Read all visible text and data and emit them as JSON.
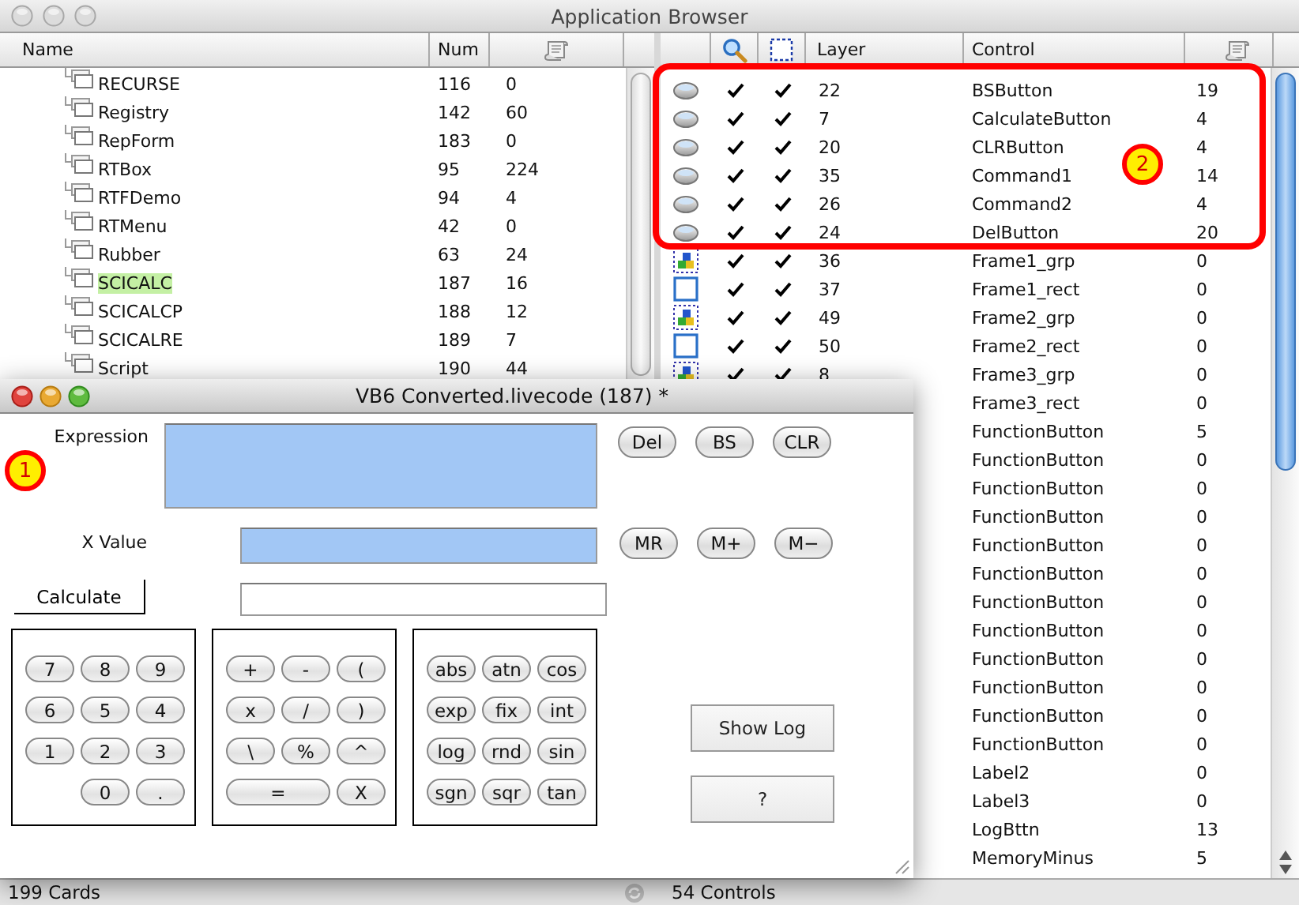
{
  "browser": {
    "title": "Application Browser",
    "active": false,
    "cards_header": {
      "name": "Name",
      "num": "Num"
    },
    "cards": [
      {
        "name": "RECURSE",
        "num": "116",
        "count": "0",
        "selected": false
      },
      {
        "name": "Registry",
        "num": "142",
        "count": "60",
        "selected": false
      },
      {
        "name": "RepForm",
        "num": "183",
        "count": "0",
        "selected": false
      },
      {
        "name": "RTBox",
        "num": "95",
        "count": "224",
        "selected": false
      },
      {
        "name": "RTFDemo",
        "num": "94",
        "count": "4",
        "selected": false
      },
      {
        "name": "RTMenu",
        "num": "42",
        "count": "0",
        "selected": false
      },
      {
        "name": "Rubber",
        "num": "63",
        "count": "24",
        "selected": false
      },
      {
        "name": "SCICALC",
        "num": "187",
        "count": "16",
        "selected": true
      },
      {
        "name": "SCICALCP",
        "num": "188",
        "count": "12",
        "selected": false
      },
      {
        "name": "SCICALRE",
        "num": "189",
        "count": "7",
        "selected": false
      },
      {
        "name": "Script",
        "num": "190",
        "count": "44",
        "selected": false
      }
    ],
    "controls_header": {
      "layer": "Layer",
      "control": "Control"
    },
    "controls": [
      {
        "kind": "button",
        "visible": true,
        "selectable": true,
        "layer": "22",
        "name": "BSButton",
        "count": "19"
      },
      {
        "kind": "button",
        "visible": true,
        "selectable": true,
        "layer": "7",
        "name": "CalculateButton",
        "count": "4"
      },
      {
        "kind": "button",
        "visible": true,
        "selectable": true,
        "layer": "20",
        "name": "CLRButton",
        "count": "4"
      },
      {
        "kind": "button",
        "visible": true,
        "selectable": true,
        "layer": "35",
        "name": "Command1",
        "count": "14"
      },
      {
        "kind": "button",
        "visible": true,
        "selectable": true,
        "layer": "26",
        "name": "Command2",
        "count": "4"
      },
      {
        "kind": "button",
        "visible": true,
        "selectable": true,
        "layer": "24",
        "name": "DelButton",
        "count": "20"
      },
      {
        "kind": "group",
        "visible": true,
        "selectable": true,
        "layer": "36",
        "name": "Frame1_grp",
        "count": "0"
      },
      {
        "kind": "rect",
        "visible": true,
        "selectable": true,
        "layer": "37",
        "name": "Frame1_rect",
        "count": "0"
      },
      {
        "kind": "group",
        "visible": true,
        "selectable": true,
        "layer": "49",
        "name": "Frame2_grp",
        "count": "0"
      },
      {
        "kind": "rect",
        "visible": true,
        "selectable": true,
        "layer": "50",
        "name": "Frame2_rect",
        "count": "0"
      },
      {
        "kind": "group",
        "visible": true,
        "selectable": true,
        "layer": "8",
        "name": "Frame3_grp",
        "count": "0"
      },
      {
        "name": "Frame3_rect",
        "count": "0"
      },
      {
        "name": "FunctionButton",
        "count": "5"
      },
      {
        "name": "FunctionButton",
        "count": "0"
      },
      {
        "name": "FunctionButton",
        "count": "0"
      },
      {
        "name": "FunctionButton",
        "count": "0"
      },
      {
        "name": "FunctionButton",
        "count": "0"
      },
      {
        "name": "FunctionButton",
        "count": "0"
      },
      {
        "name": "FunctionButton",
        "count": "0"
      },
      {
        "name": "FunctionButton",
        "count": "0"
      },
      {
        "name": "FunctionButton",
        "count": "0"
      },
      {
        "name": "FunctionButton",
        "count": "0"
      },
      {
        "name": "FunctionButton",
        "count": "0"
      },
      {
        "name": "FunctionButton",
        "count": "0"
      },
      {
        "name": "Label2",
        "count": "0"
      },
      {
        "name": "Label3",
        "count": "0"
      },
      {
        "name": "LogBttn",
        "count": "13"
      },
      {
        "name": "MemoryMinus",
        "count": "5"
      }
    ],
    "status": {
      "cards": "199 Cards",
      "controls": "54 Controls"
    }
  },
  "calculator": {
    "title": "VB6 Converted.livecode (187) *",
    "active": true,
    "expression_label": "Expression",
    "x_label": "X  Value",
    "calculate": "Calculate",
    "edit_buttons": [
      "Del",
      "BS",
      "CLR"
    ],
    "memory_buttons": [
      "MR",
      "M+",
      "M−"
    ],
    "keypads": [
      {
        "keys": [
          {
            "label": "7",
            "kind": "key"
          },
          {
            "label": "8",
            "kind": "key"
          },
          {
            "label": "9",
            "kind": "key"
          },
          {
            "label": "6",
            "kind": "key"
          },
          {
            "label": "5",
            "kind": "key"
          },
          {
            "label": "4",
            "kind": "key"
          },
          {
            "label": "1",
            "kind": "key"
          },
          {
            "label": "2",
            "kind": "key"
          },
          {
            "label": "3",
            "kind": "key"
          },
          {
            "label": "0",
            "kind": "shifted"
          },
          {
            "label": ".",
            "kind": "key"
          }
        ]
      },
      {
        "keys": [
          {
            "label": "+",
            "kind": "key"
          },
          {
            "label": "-",
            "kind": "key"
          },
          {
            "label": "(",
            "kind": "key"
          },
          {
            "label": "x",
            "kind": "key"
          },
          {
            "label": "/",
            "kind": "key"
          },
          {
            "label": ")",
            "kind": "key"
          },
          {
            "label": "\\",
            "kind": "key"
          },
          {
            "label": "%",
            "kind": "key"
          },
          {
            "label": "^",
            "kind": "key"
          },
          {
            "label": "=",
            "kind": "wide"
          },
          {
            "label": "X",
            "kind": "key"
          }
        ]
      },
      {
        "keys": [
          {
            "label": "abs",
            "kind": "key"
          },
          {
            "label": "atn",
            "kind": "key"
          },
          {
            "label": "cos",
            "kind": "key"
          },
          {
            "label": "exp",
            "kind": "key"
          },
          {
            "label": "fix",
            "kind": "key"
          },
          {
            "label": "int",
            "kind": "key"
          },
          {
            "label": "log",
            "kind": "key"
          },
          {
            "label": "rnd",
            "kind": "key"
          },
          {
            "label": "sin",
            "kind": "key"
          },
          {
            "label": "sgn",
            "kind": "key"
          },
          {
            "label": "sqr",
            "kind": "key"
          },
          {
            "label": "tan",
            "kind": "key"
          }
        ]
      }
    ],
    "side_buttons": [
      "Show Log",
      "?"
    ]
  },
  "annotations": [
    {
      "label": "1"
    },
    {
      "label": "2"
    }
  ]
}
